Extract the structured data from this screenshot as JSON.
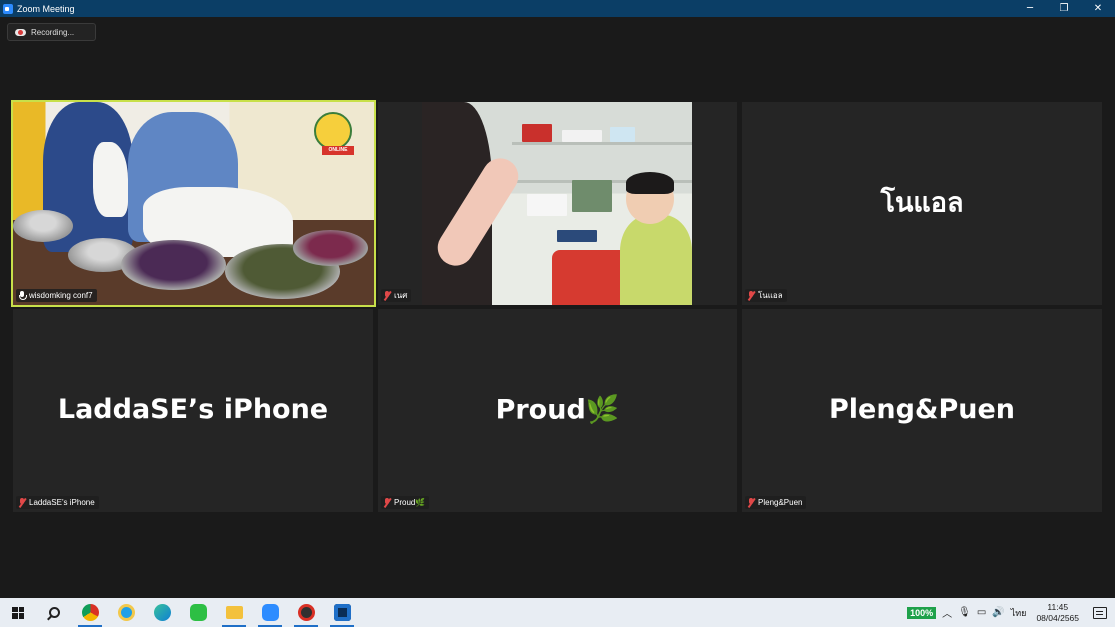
{
  "window": {
    "title": "Zoom Meeting",
    "minimize_glyph": "─",
    "restore_glyph": "❐",
    "close_glyph": "✕"
  },
  "meeting": {
    "recording_label": "Recording...",
    "active_speaker_color": "#c8e04a",
    "participants": [
      {
        "name": "wisdomking conf7",
        "display": "",
        "muted": false,
        "video": true
      },
      {
        "name": "เนศ",
        "display": "",
        "muted": true,
        "video": true
      },
      {
        "name": "โนแอล",
        "display": "โนแอล",
        "muted": true,
        "video": false
      },
      {
        "name": "LaddaSE’s iPhone",
        "display": "LaddaSE’s iPhone",
        "muted": true,
        "video": false
      },
      {
        "name": "Proud🌿",
        "display": "Proud🌿",
        "muted": true,
        "video": false
      },
      {
        "name": "Pleng&Puen",
        "display": "Pleng&Puen",
        "muted": true,
        "video": false
      }
    ],
    "video_overlay_text": "ONLINE"
  },
  "taskbar": {
    "apps": [
      {
        "icon": "windows-start-icon"
      },
      {
        "icon": "search-icon"
      },
      {
        "icon": "chrome-icon",
        "color": "#d93025"
      },
      {
        "icon": "internet-explorer-icon",
        "color": "#1ea0e8"
      },
      {
        "icon": "edge-icon",
        "color": "#0f7fd4"
      },
      {
        "icon": "line-icon",
        "color": "#2dbf44"
      },
      {
        "icon": "file-explorer-icon",
        "color": "#f3c13c"
      },
      {
        "icon": "zoom-icon",
        "color": "#2d8cff"
      },
      {
        "icon": "screen-recorder-icon",
        "color": "#303030"
      },
      {
        "icon": "webex-icon",
        "color": "#0a2d56"
      }
    ],
    "tray": {
      "battery": "100%",
      "language": "ไทย",
      "time": "11:45",
      "date": "08/04/2565"
    }
  }
}
